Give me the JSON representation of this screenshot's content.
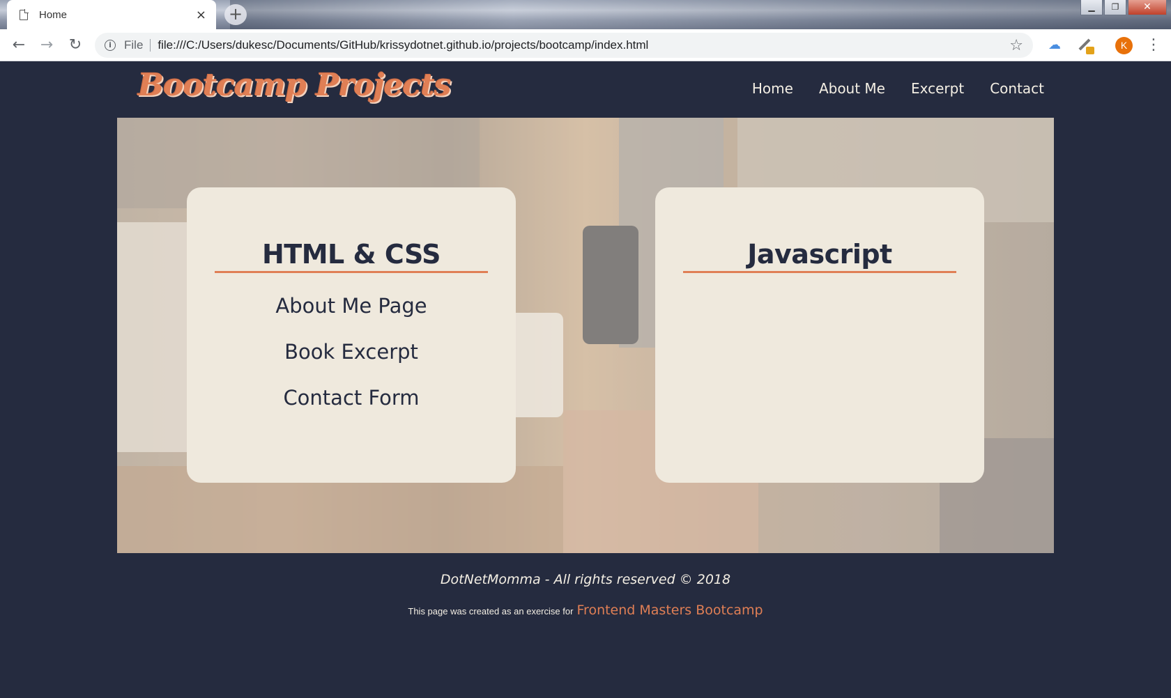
{
  "browser": {
    "tab_title": "Home",
    "tab_close": "×",
    "new_tab": "+",
    "file_label": "File",
    "url": "file:///C:/Users/dukesc/Documents/GitHub/krissydotnet.github.io/projects/bootcamp/index.html",
    "avatar_letter": "K"
  },
  "site": {
    "logo": "Bootcamp Projects",
    "nav": [
      "Home",
      "About Me",
      "Excerpt",
      "Contact"
    ]
  },
  "cards": {
    "html_css": {
      "title": "HTML & CSS",
      "links": [
        "About Me Page",
        "Book Excerpt",
        "Contact Form"
      ]
    },
    "javascript": {
      "title": "Javascript"
    }
  },
  "footer": {
    "rights": "DotNetMomma - All rights reserved © 2018",
    "credit_text": "This page was created as an exercise for",
    "credit_link": "Frontend Masters Bootcamp"
  },
  "colors": {
    "page_bg": "#252b3f",
    "accent": "#e07f55",
    "card_bg": "#efe9dd"
  }
}
